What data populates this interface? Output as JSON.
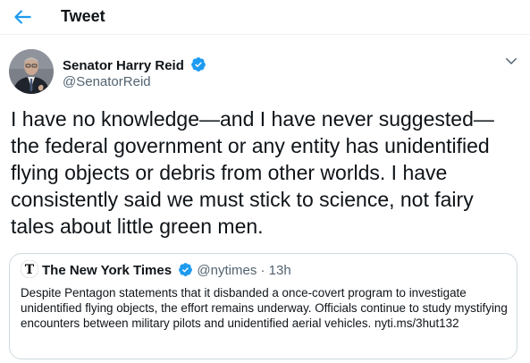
{
  "header": {
    "title": "Tweet",
    "back_icon": "arrow-left-icon"
  },
  "tweet": {
    "author_name": "Senator Harry Reid",
    "author_handle": "@SenatorReid",
    "verified_icon": "verified-badge-icon",
    "more_icon": "chevron-down-icon",
    "text": "I have no knowledge—and I have never suggested— the federal government or any entity has unidentified flying objects or debris from other worlds. I have consistently said we must stick to science, not fairy tales about little green men."
  },
  "quoted_tweet": {
    "author_name": "The New York Times",
    "author_handle": "@nytimes",
    "separator": "·",
    "time": "13h",
    "text": "Despite Pentagon statements that it disbanded a once-covert program to investigate unidentified flying objects, the effort remains underway. Officials continue to study mystifying encounters between military pilots and unidentified aerial vehicles. nyti.ms/3hut132"
  },
  "colors": {
    "accent": "#1d9bf0",
    "text_primary": "#0f1419",
    "text_secondary": "#536471",
    "border": "#cfd9de"
  }
}
